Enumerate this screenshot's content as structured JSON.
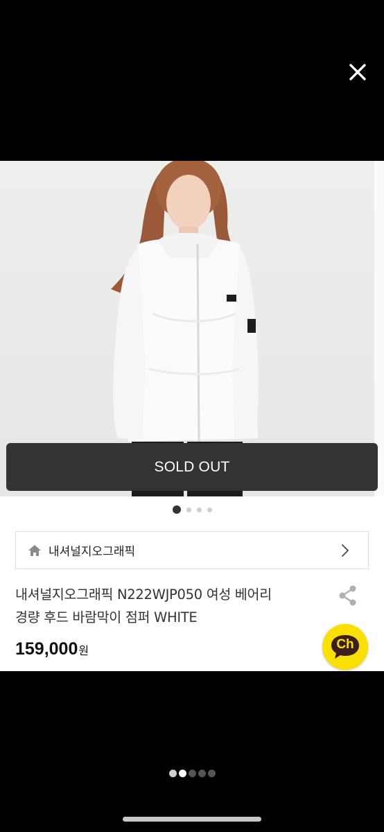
{
  "viewer": {
    "close_icon": "close-icon",
    "gallery_dots": {
      "count": 5,
      "active_index": 1
    }
  },
  "product": {
    "status_label": "SOLD OUT",
    "image_dots": {
      "count": 4,
      "active_index": 0
    },
    "store": {
      "name": "내셔널지오그래픽",
      "icon": "home-icon",
      "chevron": "chevron-right-icon"
    },
    "title_line1": "내셔널지오그래픽 N222WJP050 여성 베어리",
    "title_line2": "경량 후드 바람막이 점퍼 WHITE",
    "price_amount": "159,000",
    "price_unit": "원",
    "share_icon": "share-icon",
    "chat_button_label": "Ch",
    "colors": {
      "sold_out_bg": "#333333",
      "kakao_yellow": "#f9e000",
      "chat_text": "#3c1e1e"
    }
  }
}
